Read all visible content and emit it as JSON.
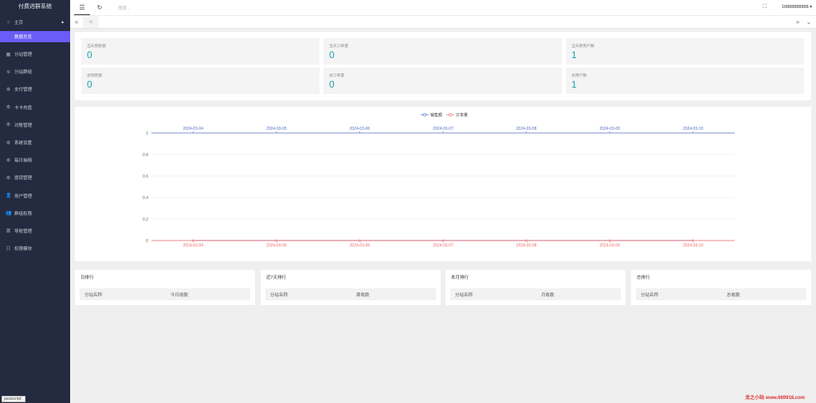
{
  "app": {
    "title": "付费进群系统"
  },
  "sidebar": {
    "home": {
      "label": "主页",
      "icon": "home-icon"
    },
    "home_sub": {
      "label": "数据总览"
    },
    "items": [
      {
        "label": "分站管理",
        "icon": "grid-icon"
      },
      {
        "label": "分站群组",
        "icon": "sliders-icon"
      },
      {
        "label": "支付管理",
        "icon": "gear-icon"
      },
      {
        "label": "卡卡充值",
        "icon": "gear-icon"
      },
      {
        "label": "对账管理",
        "icon": "gear-icon"
      },
      {
        "label": "系统设置",
        "icon": "gear-icon"
      },
      {
        "label": "每日抽佣",
        "icon": "gear-icon"
      },
      {
        "label": "提现管理",
        "icon": "gear-icon"
      },
      {
        "label": "用户管理",
        "icon": "user-icon"
      },
      {
        "label": "群组权限",
        "icon": "users-icon"
      },
      {
        "label": "导航管理",
        "icon": "chart-icon"
      },
      {
        "label": "权限模块",
        "icon": "list-icon"
      }
    ],
    "status_tooltip": "javascript:;"
  },
  "topbar": {
    "search_placeholder": "搜索...",
    "user": "18888888888"
  },
  "stats": [
    {
      "label": "当天销售额",
      "value": "0"
    },
    {
      "label": "当天订单量",
      "value": "0"
    },
    {
      "label": "当天新用户数",
      "value": "1"
    },
    {
      "label": "总销售额",
      "value": "0"
    },
    {
      "label": "总订单量",
      "value": "0"
    },
    {
      "label": "总用户数",
      "value": "1"
    }
  ],
  "chart_data": {
    "type": "line",
    "x": [
      "2024-03-04",
      "2024-03-05",
      "2024-03-06",
      "2024-03-07",
      "2024-03-08",
      "2024-03-09",
      "2024-03-10"
    ],
    "series": [
      {
        "name": "销售额",
        "values": [
          0,
          0,
          0,
          0,
          0,
          0,
          0
        ],
        "color": "#5470c6",
        "axis": "top"
      },
      {
        "name": "订单量",
        "values": [
          0,
          0,
          0,
          0,
          0,
          0,
          0
        ],
        "color": "#ee6666",
        "axis": "bottom"
      }
    ],
    "yticks": [
      "1",
      "0.8",
      "0.6",
      "0.4",
      "0.2",
      "0"
    ],
    "ylim": [
      0,
      1
    ],
    "legend": "top-center",
    "grid": true
  },
  "rankings": [
    {
      "title": "日排行",
      "col1": "分站名称",
      "col2": "今日收款"
    },
    {
      "title": "近7天排行",
      "col1": "分站名称",
      "col2": "周收款"
    },
    {
      "title": "本月排行",
      "col1": "分站名称",
      "col2": "月收款"
    },
    {
      "title": "总排行",
      "col1": "分站名称",
      "col2": "总收款"
    }
  ],
  "watermark": "龙之小站 www.689918.com"
}
